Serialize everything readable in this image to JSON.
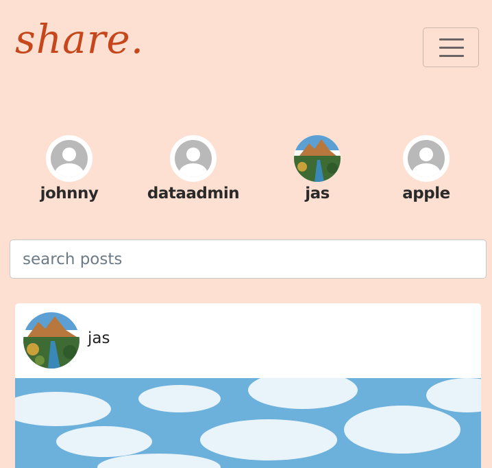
{
  "header": {
    "logo": "share.",
    "menu_icon": "hamburger-icon"
  },
  "users": [
    {
      "name": "johnny",
      "avatar": "default-avatar-icon"
    },
    {
      "name": "dataadmin",
      "avatar": "default-avatar-icon"
    },
    {
      "name": "jas",
      "avatar": "landscape-photo"
    },
    {
      "name": "apple",
      "avatar": "default-avatar-icon"
    }
  ],
  "search": {
    "placeholder": "search posts",
    "value": ""
  },
  "post": {
    "author": "jas",
    "author_avatar": "landscape-photo",
    "image": "sky-clouds-photo"
  },
  "colors": {
    "background": "#fde0d2",
    "logo": "#c7471c",
    "card": "#ffffff"
  }
}
